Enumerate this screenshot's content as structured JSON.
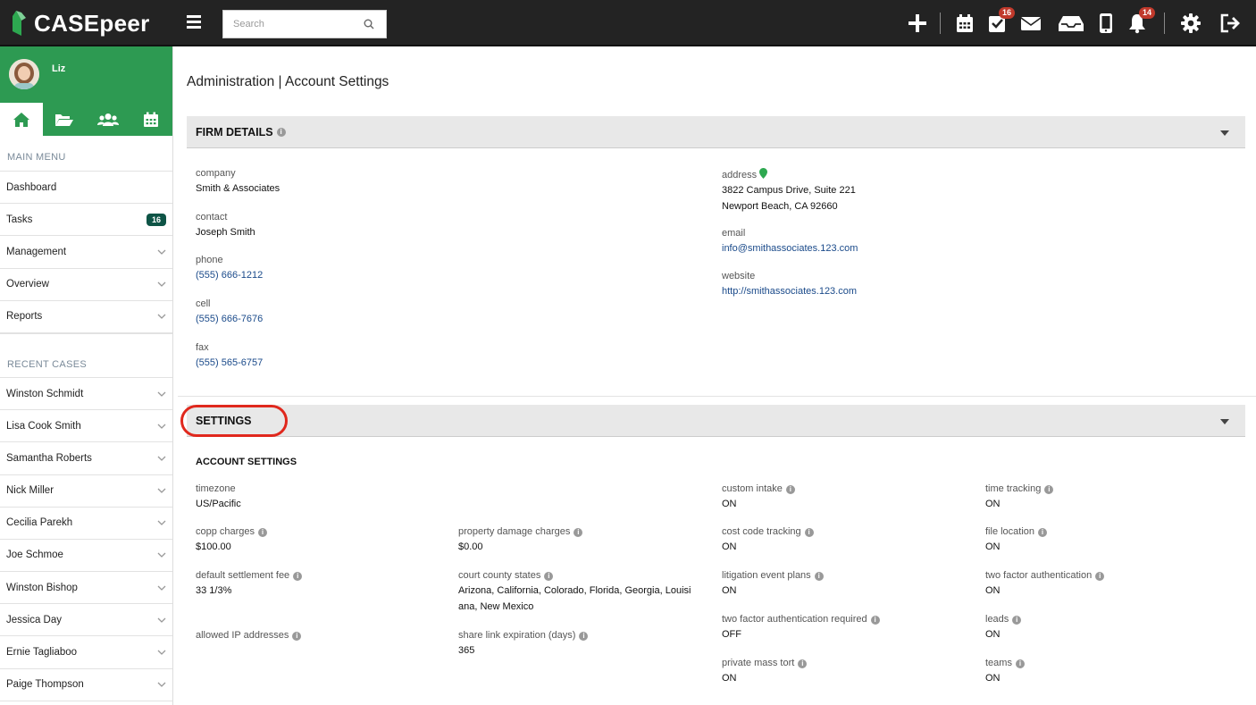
{
  "app": {
    "name": "CASEpeer"
  },
  "topbar": {
    "search_placeholder": "Search",
    "tasks_badge": "16",
    "notifications_badge": "14"
  },
  "sidebar": {
    "user_name": "Liz",
    "main_menu_title": "MAIN MENU",
    "main_menu": [
      {
        "label": "Dashboard"
      },
      {
        "label": "Tasks",
        "badge": "16"
      },
      {
        "label": "Management"
      },
      {
        "label": "Overview"
      },
      {
        "label": "Reports"
      }
    ],
    "recent_cases_title": "RECENT CASES",
    "recent_cases": [
      "Winston Schmidt",
      "Lisa Cook Smith",
      "Samantha Roberts",
      "Nick Miller",
      "Cecilia Parekh",
      "Joe Schmoe",
      "Winston Bishop",
      "Jessica Day",
      "Ernie Tagliaboo",
      "Paige Thompson"
    ]
  },
  "main": {
    "breadcrumb": "Administration | Account Settings",
    "firm_details": {
      "title": "FIRM DETAILS",
      "company_label": "company",
      "company": "Smith & Associates",
      "contact_label": "contact",
      "contact": "Joseph Smith",
      "phone_label": "phone",
      "phone": "(555) 666-1212",
      "cell_label": "cell",
      "cell": "(555) 666-7676",
      "fax_label": "fax",
      "fax": "(555) 565-6757",
      "address_label": "address",
      "address_line1": "3822 Campus Drive, Suite 221",
      "address_line2": "Newport Beach, CA 92660",
      "email_label": "email",
      "email": "info@smithassociates.123.com",
      "website_label": "website",
      "website": "http://smithassociates.123.com"
    },
    "settings": {
      "title": "SETTINGS",
      "account_settings_title": "ACCOUNT SETTINGS",
      "timezone_label": "timezone",
      "timezone": "US/Pacific",
      "copp_label": "copp charges",
      "copp": "$100.00",
      "pdc_label": "property damage charges",
      "pdc": "$0.00",
      "dsf_label": "default settlement fee",
      "dsf": "33 1/3%",
      "ccs_label": "court county states",
      "ccs_line1": "Arizona, California, Colorado, Florida, Georgia, Louisi",
      "ccs_line2": "ana, New Mexico",
      "ip_label": "allowed IP addresses",
      "sle_label": "share link expiration (days)",
      "sle": "365",
      "ci_label": "custom intake",
      "ci": "ON",
      "cct_label": "cost code tracking",
      "cct": "ON",
      "lep_label": "litigation event plans",
      "lep": "ON",
      "tfar_label": "two factor authentication required",
      "tfar": "OFF",
      "pmt_label": "private mass tort",
      "pmt": "ON",
      "tt_label": "time tracking",
      "tt": "ON",
      "fl_label": "file location",
      "fl": "ON",
      "tfa_label": "two factor authentication",
      "tfa": "ON",
      "leads_label": "leads",
      "leads": "ON",
      "teams_label": "teams",
      "teams": "ON"
    }
  }
}
